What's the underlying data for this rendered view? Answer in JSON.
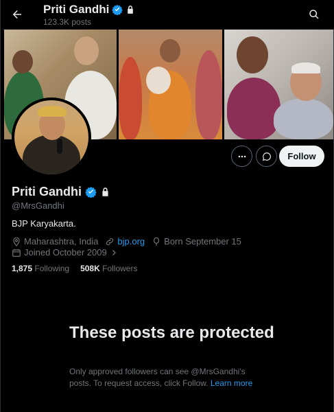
{
  "header": {
    "title": "Priti Gandhi",
    "post_count": "123.3K posts"
  },
  "profile": {
    "name": "Priti Gandhi",
    "handle": "@MrsGandhi",
    "bio": "BJP Karyakarta.",
    "location": "Maharashtra, India",
    "website": "bjp.org",
    "birthday": "Born September 15",
    "joined": "Joined October 2009",
    "following_count": "1,875",
    "following_label": "Following",
    "followers_count": "508K",
    "followers_label": "Followers",
    "follow_button": "Follow"
  },
  "protected": {
    "title": "These posts are protected",
    "body_prefix": "Only approved followers can see @MrsGandhi's posts. To request access, click Follow.",
    "learn_more": "Learn more"
  },
  "icons": {
    "back": "arrow-left-icon",
    "search": "search-icon",
    "verified": "verified-badge-icon",
    "lock": "lock-icon",
    "more": "more-dots-icon",
    "message": "message-icon",
    "location": "location-icon",
    "link": "link-icon",
    "birthday": "balloon-icon",
    "calendar": "calendar-icon"
  },
  "colors": {
    "accent": "#1d9bf0",
    "background": "#000000",
    "text_primary": "#e7e9ea",
    "text_secondary": "#71767b"
  }
}
